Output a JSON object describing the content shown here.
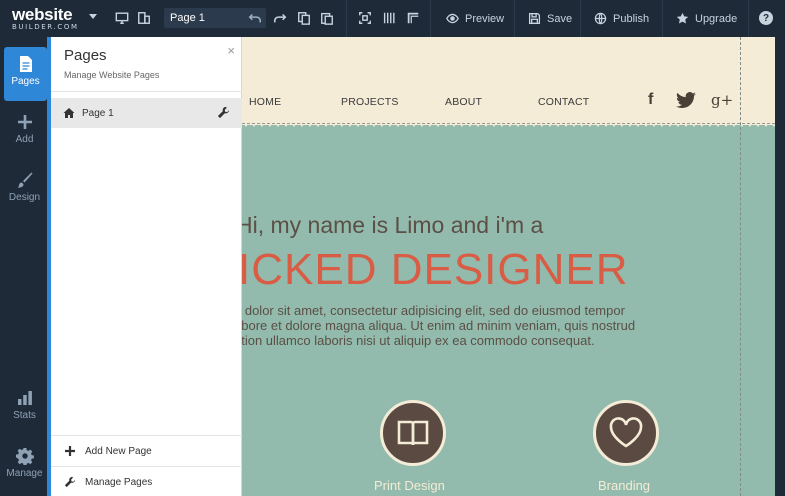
{
  "topbar": {
    "logo_line1": "website",
    "logo_line2": "BUILDER.COM",
    "page_select": "Page 1",
    "preview_label": "Preview",
    "save_label": "Save",
    "publish_label": "Publish",
    "upgrade_label": "Upgrade",
    "help_label": "?"
  },
  "leftnav": {
    "items": [
      {
        "label": "Pages",
        "icon": "document-icon"
      },
      {
        "label": "Add",
        "icon": "plus-icon"
      },
      {
        "label": "Design",
        "icon": "brush-icon"
      },
      {
        "label": "Stats",
        "icon": "bar-chart-icon"
      },
      {
        "label": "Manage",
        "icon": "gear-icon"
      }
    ]
  },
  "panel": {
    "title": "Pages",
    "subtitle": "Manage Website Pages",
    "close": "×",
    "pages": [
      {
        "label": "Page 1"
      }
    ],
    "add_new_page": "Add New Page",
    "manage_pages": "Manage Pages"
  },
  "site": {
    "nav": [
      "HOME",
      "PROJECTS",
      "ABOUT",
      "CONTACT"
    ],
    "social": {
      "facebook": "f",
      "googleplus": "g+"
    },
    "hero_line1": "Hi, my name is Limo and i'm a",
    "hero_line2": "ICKED DESIGNER",
    "hero_paragraph": [
      "n dolor sit amet, consectetur adipisicing elit, sed do eiusmod tempor",
      "abore et dolore magna aliqua. Ut enim ad minim veniam, quis nostrud",
      "ation ullamco laboris nisi ut aliquip ex ea commodo consequat."
    ],
    "features": [
      {
        "label": "Print Design",
        "icon": "book-icon"
      },
      {
        "label": "Branding",
        "icon": "heart-icon"
      }
    ]
  },
  "colors": {
    "toolbar_bg": "#1e2a38",
    "accent": "#2f87d8",
    "site_bg": "#92bbad",
    "header_bg": "#f4ecd6",
    "hero_accent": "#d95c45",
    "dark_brown": "#5a4a42"
  }
}
